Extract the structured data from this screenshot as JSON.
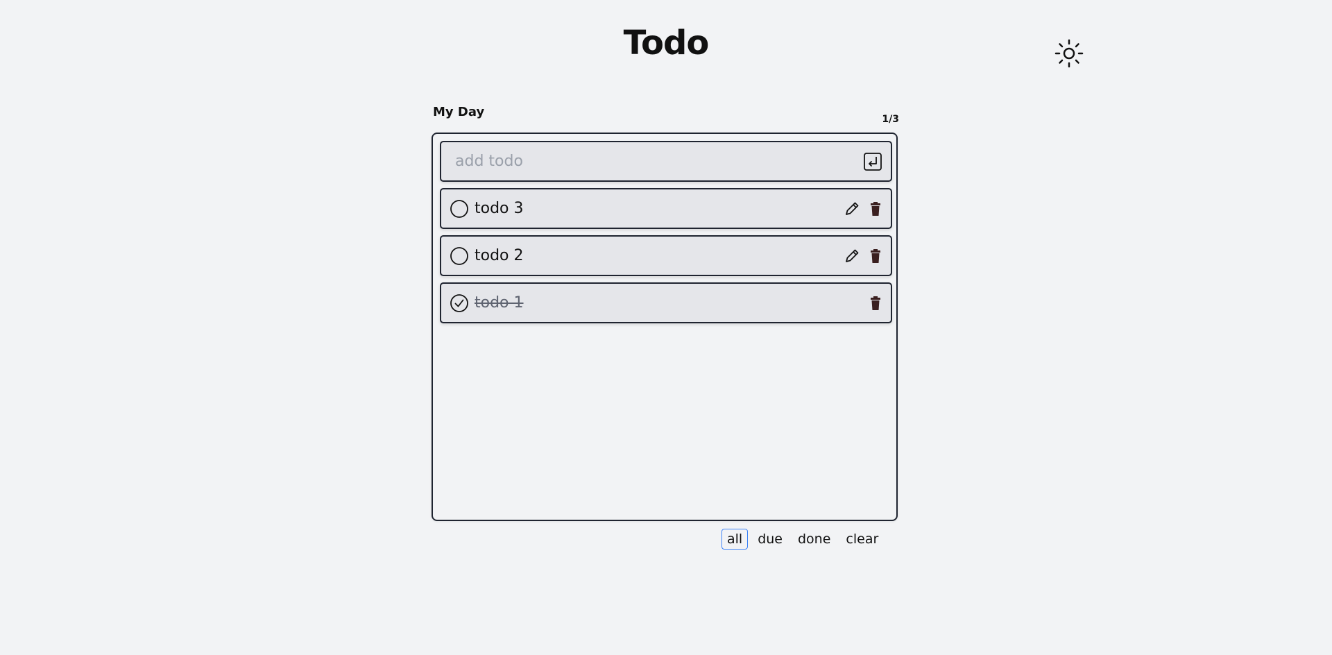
{
  "header": {
    "title": "Todo",
    "theme_icon": "sun-icon"
  },
  "list": {
    "title": "My Day",
    "counter": "1/3",
    "add": {
      "placeholder": "add todo",
      "value": "",
      "icon": "enter-icon"
    },
    "items": [
      {
        "text": "todo 3",
        "done": false
      },
      {
        "text": "todo 2",
        "done": false
      },
      {
        "text": "todo 1",
        "done": true
      }
    ]
  },
  "filters": {
    "all": "all",
    "due": "due",
    "done": "done",
    "clear": "clear",
    "active": "all"
  },
  "colors": {
    "background": "#f2f3f5",
    "row": "#e5e6ea",
    "border": "#1f2430",
    "trash": "#3a1f1f",
    "active_filter": "#3b82f6"
  }
}
